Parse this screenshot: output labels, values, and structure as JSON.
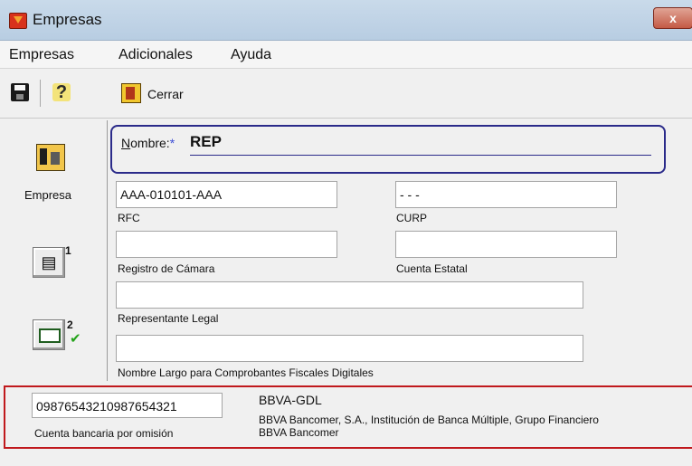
{
  "window": {
    "title": "Empresas",
    "close_glyph": "x"
  },
  "menu": [
    "Empresas",
    "Adicionales",
    "Ayuda"
  ],
  "toolbar": {
    "cerrar_label": "Cerrar",
    "help_glyph": "?"
  },
  "left_panel": {
    "empresa_label": "Empresa",
    "btn1_badge": "1",
    "btn2_badge": "2",
    "check_glyph": "✔"
  },
  "form": {
    "nombre_label_u": "N",
    "nombre_label_rest": "ombre:",
    "nombre_required": "*",
    "nombre_value": "REP",
    "rfc_value": "AAA-010101-AAA",
    "rfc_label": "RFC",
    "curp_value": "-    -    -",
    "curp_label": "CURP",
    "registro_value": "",
    "registro_label": "Registro de Cámara",
    "cuenta_estatal_value": "",
    "cuenta_estatal_label": "Cuenta Estatal",
    "representante_value": "",
    "representante_label": "Representante Legal",
    "nombre_largo_value": "",
    "nombre_largo_label": "Nombre Largo para Comprobantes Fiscales Digitales"
  },
  "bank": {
    "account_value": "09876543210987654321",
    "account_label": "Cuenta bancaria por omisión",
    "code": "BBVA-GDL",
    "name_line1": "BBVA Bancomer, S.A., Institución de Banca Múltiple, Grupo Financiero",
    "name_line2": "BBVA Bancomer"
  }
}
